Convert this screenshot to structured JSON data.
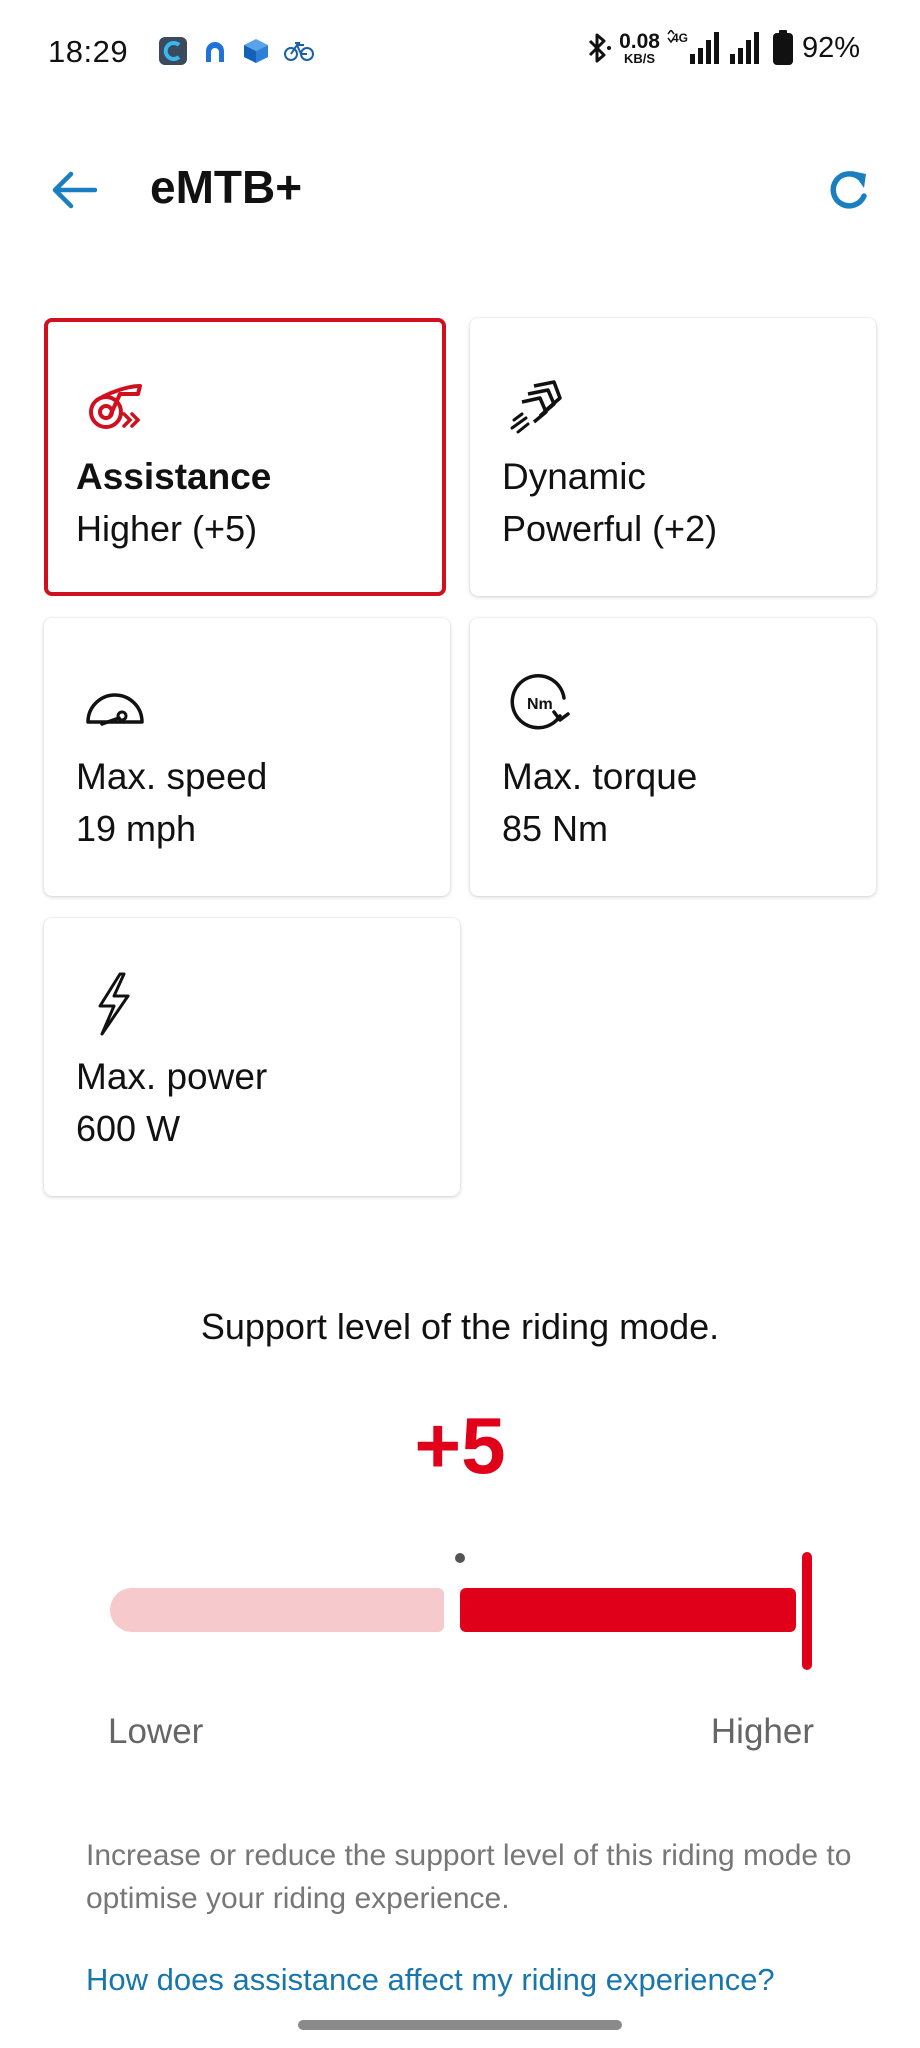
{
  "status_bar": {
    "time": "18:29",
    "net_speed_value": "0.08",
    "net_speed_unit": "KB/S",
    "network_type": "4G",
    "battery_percent": "92%"
  },
  "header": {
    "title": "eMTB+"
  },
  "tiles": [
    {
      "title": "Assistance",
      "value": "Higher (+5)",
      "icon": "assistance-icon",
      "selected": true
    },
    {
      "title": "Dynamic",
      "value": "Powerful (+2)",
      "icon": "dynamic-icon"
    },
    {
      "title": "Max. speed",
      "value": "19 mph",
      "icon": "speedometer-icon"
    },
    {
      "title": "Max. torque",
      "value": "85 Nm",
      "icon": "torque-icon",
      "icon_text": "Nm"
    },
    {
      "title": "Max. power",
      "value": "600 W",
      "icon": "lightning-icon"
    }
  ],
  "support": {
    "heading": "Support level of the riding mode.",
    "value": "+5",
    "slider_fraction": 1.0,
    "label_lower": "Lower",
    "label_higher": "Higher",
    "description": "Increase or reduce the support level of this riding mode to optimise your riding experience.",
    "help_link": "How does assistance affect my riding experience?"
  },
  "colors": {
    "accent_red": "#e0001a",
    "track_light": "#f6c9cd",
    "link_blue": "#1777ad",
    "icon_blue": "#1a7fc1"
  }
}
